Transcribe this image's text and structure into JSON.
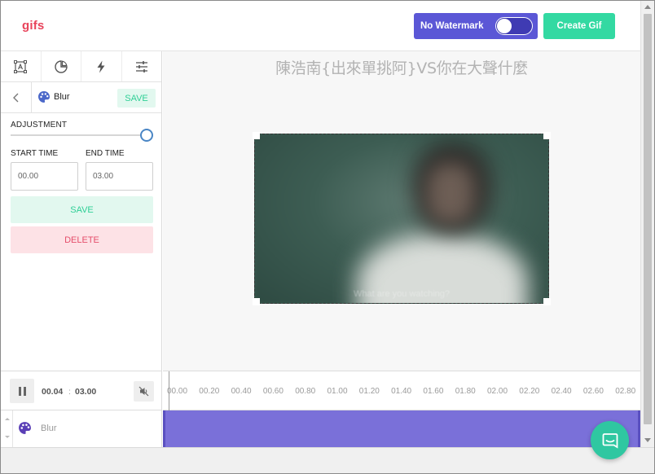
{
  "header": {
    "logo": "gifs",
    "watermark_label": "No Watermark",
    "watermark_on": false,
    "create_label": "Create Gif"
  },
  "sidebar": {
    "tool_tabs": [
      {
        "name": "text-box-icon"
      },
      {
        "name": "sticker-icon"
      },
      {
        "name": "effects-bolt-icon"
      },
      {
        "name": "adjust-sliders-icon"
      }
    ],
    "sub_header": {
      "back_icon": "chevron-left-icon",
      "icon": "palette-icon",
      "label": "Blur",
      "save_label": "SAVE"
    },
    "adjustment_label": "ADJUSTMENT",
    "adjustment_level": 1.0,
    "start_time_label": "START TIME",
    "end_time_label": "END TIME",
    "start_time_value": "00.00",
    "end_time_value": "03.00",
    "save_label": "SAVE",
    "delete_label": "DELETE"
  },
  "main": {
    "title": "陳浩南{出來單挑阿}VS你在大聲什麼",
    "subtitle": "What are you watching?"
  },
  "timeline": {
    "current_time": "00.04",
    "separator": ":",
    "total_time": "03.00",
    "mute_icon": "volume-mute-icon",
    "ticks": [
      "00.00",
      "00.20",
      "00.40",
      "00.60",
      "00.80",
      "01.00",
      "01.20",
      "01.40",
      "01.60",
      "01.80",
      "02.00",
      "02.20",
      "02.40",
      "02.60",
      "02.80"
    ],
    "layer_label": "Blur",
    "layer_icon": "palette-icon"
  },
  "colors": {
    "brand": "#e8435b",
    "watermark_button": "#5b57d6",
    "create_button": "#33d9a2",
    "track": "#7a70d9",
    "save_text": "#2fcf96",
    "delete_text": "#e54e6b",
    "chat_button": "#2fc7a1"
  },
  "chat_icon": "chat-bubble-icon"
}
